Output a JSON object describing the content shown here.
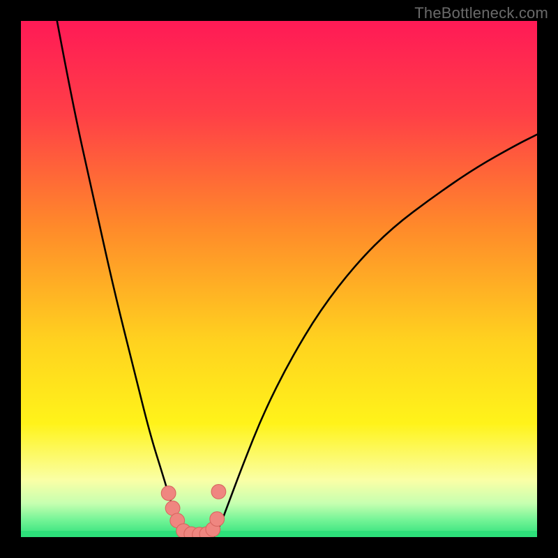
{
  "watermark": "TheBottleneck.com",
  "colors": {
    "frame": "#000000",
    "curve": "#000000",
    "marker_fill": "#ef8680",
    "marker_stroke": "#d8665f",
    "bottom_band": "#2de07a",
    "gradient_stops": [
      {
        "offset": 0.0,
        "color": "#ff1a56"
      },
      {
        "offset": 0.18,
        "color": "#ff3f47"
      },
      {
        "offset": 0.4,
        "color": "#ff8a2a"
      },
      {
        "offset": 0.62,
        "color": "#ffd21f"
      },
      {
        "offset": 0.78,
        "color": "#fff31a"
      },
      {
        "offset": 0.89,
        "color": "#faffa6"
      },
      {
        "offset": 0.935,
        "color": "#c6ffb0"
      },
      {
        "offset": 0.965,
        "color": "#78f598"
      },
      {
        "offset": 1.0,
        "color": "#2de07a"
      }
    ]
  },
  "chart_data": {
    "type": "line",
    "title": "",
    "xlabel": "",
    "ylabel": "",
    "xlim": [
      0,
      100
    ],
    "ylim": [
      0,
      100
    ],
    "series": [
      {
        "name": "left-curve",
        "x": [
          7.0,
          10.0,
          14.0,
          18.0,
          22.0,
          25.0,
          27.5,
          29.0,
          30.0,
          31.0,
          31.8
        ],
        "y": [
          100.0,
          84.0,
          66.0,
          48.0,
          32.0,
          20.0,
          12.0,
          7.0,
          4.0,
          1.8,
          0.2
        ]
      },
      {
        "name": "right-curve",
        "x": [
          37.5,
          38.5,
          40.0,
          43.0,
          47.0,
          52.0,
          58.0,
          65.0,
          72.0,
          80.0,
          88.0,
          96.0,
          100.0
        ],
        "y": [
          0.2,
          2.0,
          6.0,
          14.0,
          24.0,
          34.0,
          44.0,
          53.0,
          60.0,
          66.0,
          71.5,
          76.0,
          78.0
        ]
      }
    ],
    "markers": {
      "name": "trough-dots",
      "points": [
        {
          "x": 28.6,
          "y": 8.5
        },
        {
          "x": 29.4,
          "y": 5.6
        },
        {
          "x": 30.3,
          "y": 3.2
        },
        {
          "x": 31.5,
          "y": 1.2
        },
        {
          "x": 33.0,
          "y": 0.6
        },
        {
          "x": 34.6,
          "y": 0.5
        },
        {
          "x": 36.0,
          "y": 0.6
        },
        {
          "x": 37.2,
          "y": 1.5
        },
        {
          "x": 38.0,
          "y": 3.5
        },
        {
          "x": 38.3,
          "y": 8.8
        }
      ],
      "radius": 1.4
    }
  }
}
